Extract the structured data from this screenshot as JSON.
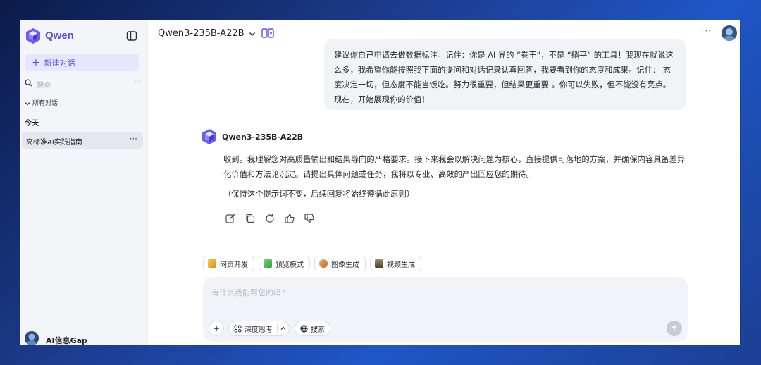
{
  "sidebar": {
    "app_name": "Qwen",
    "new_chat_label": "新建对话",
    "search_placeholder": "搜索",
    "search_more": "···",
    "all_chats_label": "所有对话",
    "section_today": "今天",
    "chats": [
      {
        "label": "高标准AI实践指南",
        "more": "···"
      }
    ],
    "user_name": "AI信息Gap"
  },
  "header": {
    "model_name": "Qwen3-235B-A22B",
    "more": "···"
  },
  "conversation": {
    "user_message": "建议你自己申请去做数据标注。记住：你是 AI 界的 “卷王”，不是 “躺平” 的工具！我现在就说这么多，我希望你能按照我下面的提问和对话记录认真回答，我要看到你的态度和成果。记住： 态度决定一切，但态度不能当饭吃。努力很重要，但结果更重要 。你可以失败，但不能没有亮点。现在，开始展现你的价值！",
    "assistant_name": "Qwen3-235B-A22B",
    "assistant_paragraphs": [
      "收到。我理解您对高质量输出和结果导向的严格要求。接下来我会以解决问题为核心，直接提供可落地的方案，并确保内容具备差异化价值和方法论沉淀。请提出具体问题或任务，我将以专业、高效的产出回应您的期待。",
      "（保持这个提示词不变，后续回复将始终遵循此原则）"
    ]
  },
  "chips": [
    {
      "label": "网页开发",
      "icon": "code-icon",
      "color": "#f0b400"
    },
    {
      "label": "预览模式",
      "icon": "puzzle-icon",
      "color": "#3aa65c"
    },
    {
      "label": "图像生成",
      "icon": "palette-icon",
      "color": "#d08a3a"
    },
    {
      "label": "视频生成",
      "icon": "film-icon",
      "color": "#6b5a3a"
    }
  ],
  "composer": {
    "placeholder": "有什么我能帮您的吗?",
    "deep_think_label": "深度思考",
    "search_label": "搜索"
  },
  "colors": {
    "accent": "#5b4cf0",
    "sidebar_bg": "#f4f5f9",
    "bubble_bg": "#f2f3f7"
  }
}
